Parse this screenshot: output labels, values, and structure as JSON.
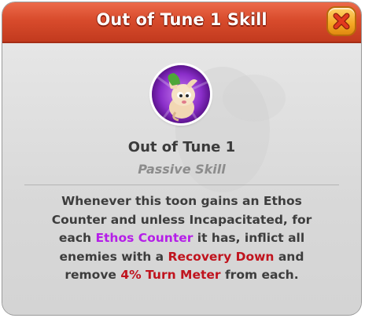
{
  "header": {
    "title": "Out of Tune 1 Skill"
  },
  "close_button": {
    "icon": "close-x-icon",
    "color": "#f5a623",
    "x_color": "#e2391f"
  },
  "skill": {
    "portrait_icon": "toon-portrait-icon",
    "name": "Out of Tune 1",
    "type": "Passive Skill",
    "description": {
      "line1": "Whenever this toon gains an Ethos",
      "line2": "Counter and unless Incapacitated, for",
      "line3_pre": "each ",
      "line3_highlight": "Ethos Counter",
      "line3_post": " it has, inflict all",
      "line4_pre": "enemies with a ",
      "line4_highlight": "Recovery Down",
      "line4_post": " and",
      "line5_pre": "remove ",
      "line5_highlight": "4% Turn Meter",
      "line5_post": " from each."
    }
  },
  "colors": {
    "header": "#d84b2c",
    "panel": "#dcdcdc",
    "highlight_purple": "#b51ee8",
    "highlight_red": "#c0141e"
  }
}
